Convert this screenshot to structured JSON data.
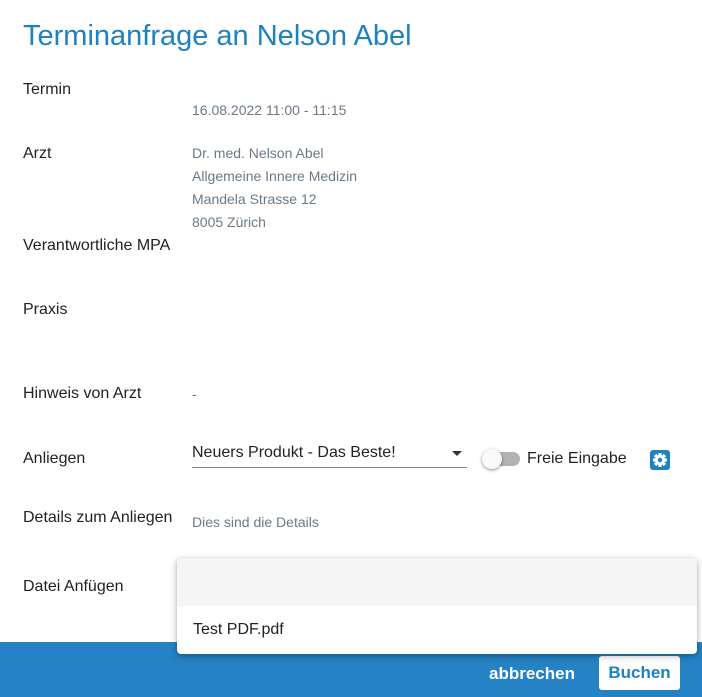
{
  "page": {
    "title": "Terminanfrage an Nelson Abel"
  },
  "fields": {
    "termin": {
      "label": "Termin",
      "value": "16.08.2022 11:00 - 11:15"
    },
    "arzt": {
      "label": "Arzt",
      "name": "Dr. med. Nelson Abel",
      "specialty": "Allgemeine Innere Medizin",
      "street": "Mandela Strasse 12",
      "city": "8005 Zürich"
    },
    "mpa": {
      "label": "Verantwortliche MPA"
    },
    "praxis": {
      "label": "Praxis"
    },
    "hinweis": {
      "label": "Hinweis von Arzt",
      "value": "-"
    },
    "anliegen": {
      "label": "Anliegen",
      "selected": "Neuers Produkt - Das Beste!",
      "toggle_label": "Freie Eingabe",
      "toggle_on": false
    },
    "details": {
      "label": "Details zum Anliegen",
      "value": "Dies sind die Details"
    },
    "datei": {
      "label": "Datei Anfügen"
    }
  },
  "dropdown": {
    "options": [
      "",
      "Test PDF.pdf"
    ]
  },
  "footer": {
    "cancel_label": "abbrechen",
    "book_label": "Buchen"
  },
  "colors": {
    "accent": "#1f82c0",
    "footer": "#2582c4",
    "muted_text": "#6b7987"
  },
  "icons": {
    "settings": "gear-icon",
    "dropdown": "caret-down-icon"
  }
}
